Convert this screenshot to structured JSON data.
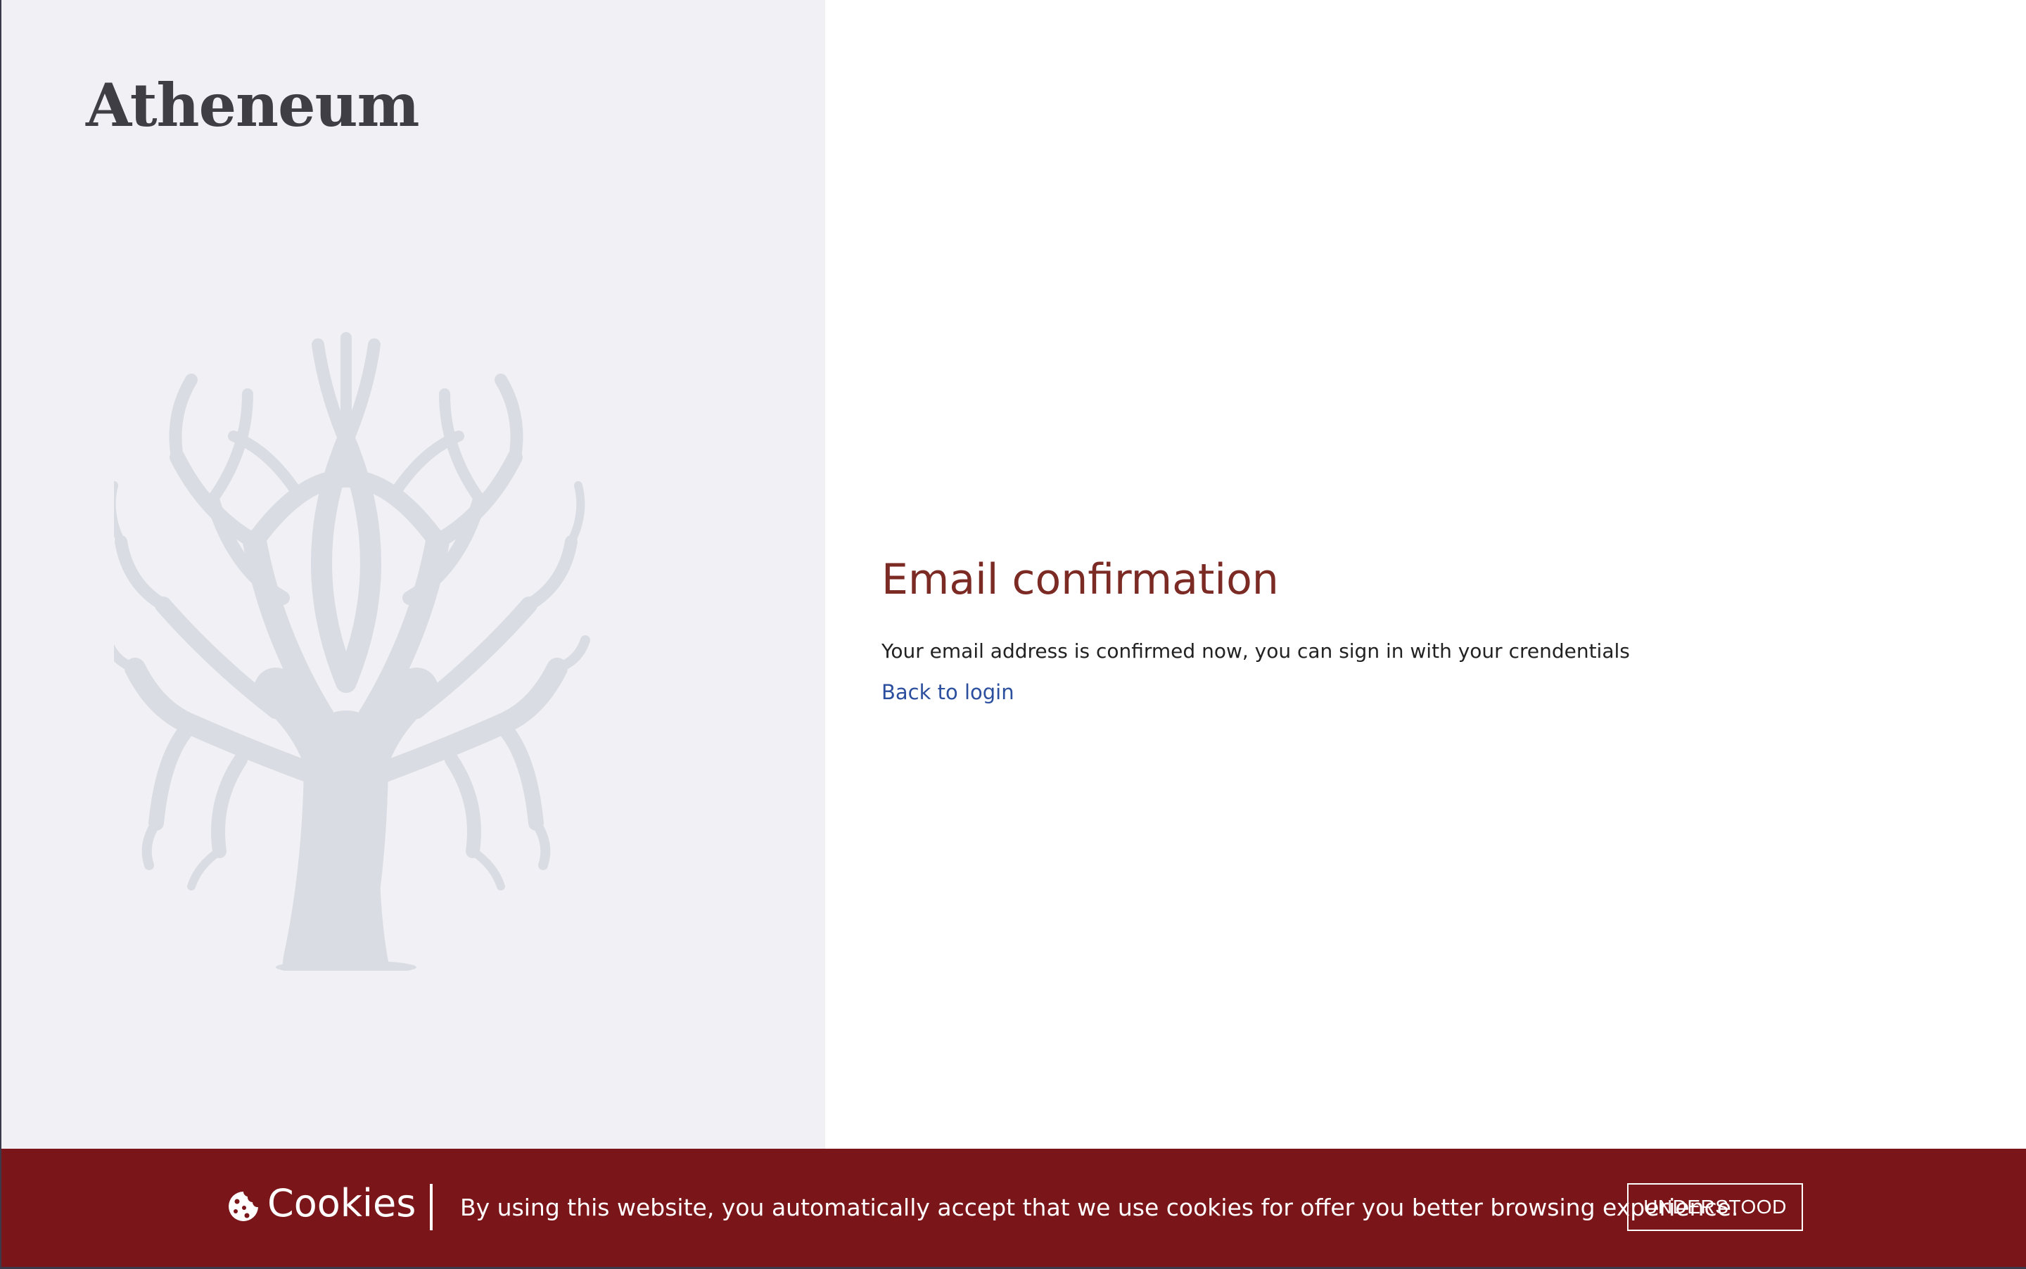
{
  "brand": {
    "name": "Atheneum"
  },
  "main": {
    "title": "Email confirmation",
    "message": "Your email address is confirmed now, you can sign in with your crendentials",
    "back_link": "Back to login"
  },
  "cookie_bar": {
    "icon": "cookie-icon",
    "title": "Cookies",
    "message": "By using this website, you automatically accept that we use cookies for offer you better browsing experience.",
    "button_label": "UNDERSTOOD"
  },
  "colors": {
    "left_panel_bg": "#f0f0f5",
    "tree": "#d9dde3",
    "title": "#7b2a24",
    "link": "#2b4f9e",
    "cookie_bar_bg": "#7a1519"
  }
}
